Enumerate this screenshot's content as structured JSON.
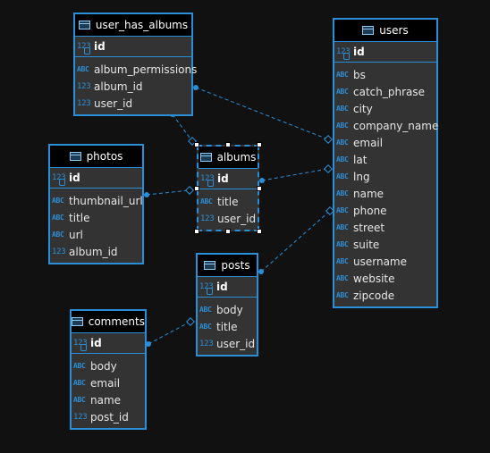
{
  "tables": [
    {
      "id": "user_has_albums",
      "title": "user_has_albums",
      "pk": {
        "type": "num",
        "name": "id"
      },
      "columns": [
        {
          "type": "abc",
          "name": "album_permissions"
        },
        {
          "type": "num",
          "name": "album_id"
        },
        {
          "type": "num",
          "name": "user_id"
        }
      ]
    },
    {
      "id": "users",
      "title": "users",
      "pk": {
        "type": "num",
        "name": "id"
      },
      "columns": [
        {
          "type": "abc",
          "name": "bs"
        },
        {
          "type": "abc",
          "name": "catch_phrase"
        },
        {
          "type": "abc",
          "name": "city"
        },
        {
          "type": "abc",
          "name": "company_name"
        },
        {
          "type": "abc",
          "name": "email"
        },
        {
          "type": "abc",
          "name": "lat"
        },
        {
          "type": "abc",
          "name": "lng"
        },
        {
          "type": "abc",
          "name": "name"
        },
        {
          "type": "abc",
          "name": "phone"
        },
        {
          "type": "abc",
          "name": "street"
        },
        {
          "type": "abc",
          "name": "suite"
        },
        {
          "type": "abc",
          "name": "username"
        },
        {
          "type": "abc",
          "name": "website"
        },
        {
          "type": "abc",
          "name": "zipcode"
        }
      ]
    },
    {
      "id": "photos",
      "title": "photos",
      "pk": {
        "type": "num",
        "name": "id"
      },
      "columns": [
        {
          "type": "abc",
          "name": "thumbnail_url"
        },
        {
          "type": "abc",
          "name": "title"
        },
        {
          "type": "abc",
          "name": "url"
        },
        {
          "type": "num",
          "name": "album_id"
        }
      ]
    },
    {
      "id": "albums",
      "title": "albums",
      "selected": true,
      "pk": {
        "type": "num",
        "name": "id"
      },
      "columns": [
        {
          "type": "abc",
          "name": "title"
        },
        {
          "type": "num",
          "name": "user_id"
        }
      ]
    },
    {
      "id": "posts",
      "title": "posts",
      "pk": {
        "type": "num",
        "name": "id"
      },
      "columns": [
        {
          "type": "abc",
          "name": "body"
        },
        {
          "type": "abc",
          "name": "title"
        },
        {
          "type": "num",
          "name": "user_id"
        }
      ]
    },
    {
      "id": "comments",
      "title": "comments",
      "pk": {
        "type": "num",
        "name": "id"
      },
      "columns": [
        {
          "type": "abc",
          "name": "body"
        },
        {
          "type": "abc",
          "name": "email"
        },
        {
          "type": "abc",
          "name": "name"
        },
        {
          "type": "num",
          "name": "post_id"
        }
      ]
    }
  ],
  "type_labels": {
    "abc": "ABC",
    "num": "123"
  },
  "colors": {
    "border": "#2b8fd8",
    "header": "#000000",
    "body": "#333333",
    "background": "#111111",
    "link": "#2b8fd8"
  }
}
